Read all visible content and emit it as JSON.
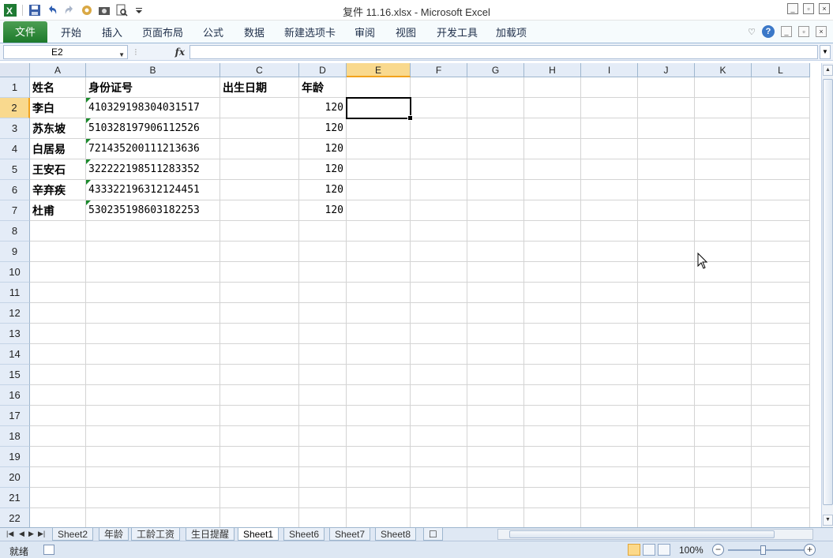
{
  "window": {
    "title": "复件 11.16.xlsx  -  Microsoft Excel"
  },
  "ribbon": {
    "file_tab": "文件",
    "tabs": [
      "开始",
      "插入",
      "页面布局",
      "公式",
      "数据",
      "新建选项卡",
      "审阅",
      "视图",
      "开发工具",
      "加载项"
    ]
  },
  "formula_bar": {
    "name_box": "E2",
    "fx_label": "fx",
    "formula": ""
  },
  "columns": [
    "A",
    "B",
    "C",
    "D",
    "E",
    "F",
    "G",
    "H",
    "I",
    "J",
    "K",
    "L"
  ],
  "selected_column": "E",
  "rows": [
    "1",
    "2",
    "3",
    "4",
    "5",
    "6",
    "7",
    "8",
    "9",
    "10",
    "11",
    "12",
    "13",
    "14",
    "15",
    "16",
    "17",
    "18",
    "19",
    "20",
    "21",
    "22"
  ],
  "selected_row": "2",
  "header_row": [
    "姓名",
    "身份证号",
    "出生日期",
    "年龄"
  ],
  "data_rows": [
    {
      "name": "李白",
      "id": "410329198304031517",
      "birth": "",
      "age": "120"
    },
    {
      "name": "苏东坡",
      "id": "510328197906112526",
      "birth": "",
      "age": "120"
    },
    {
      "name": "白居易",
      "id": "721435200111213636",
      "birth": "",
      "age": "120"
    },
    {
      "name": "王安石",
      "id": "322222198511283352",
      "birth": "",
      "age": "120"
    },
    {
      "name": "辛弃疾",
      "id": "433322196312124451",
      "birth": "",
      "age": "120"
    },
    {
      "name": "杜甫",
      "id": "530235198603182253",
      "birth": "",
      "age": "120"
    }
  ],
  "sheet_tabs": [
    "Sheet2",
    "年龄",
    "工龄工资",
    "生日提醒",
    "Sheet1",
    "Sheet6",
    "Sheet7",
    "Sheet8"
  ],
  "active_sheet": "Sheet1",
  "status": {
    "ready": "就绪",
    "zoom": "100%"
  },
  "colors": {
    "file_tab": "#1d7a2b",
    "selection_header": "#f9d98e",
    "error_triangle": "#1b8a2c"
  }
}
